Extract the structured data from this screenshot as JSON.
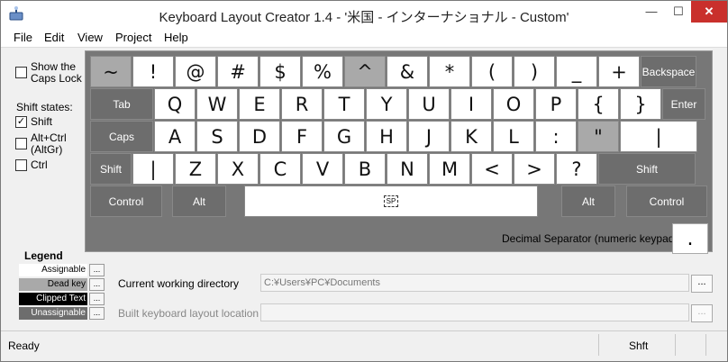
{
  "window": {
    "title": "Keyboard Layout Creator 1.4 - '米国 - インターナショナル - Custom'",
    "minimize": "—",
    "maximize": "☐",
    "close": "✕"
  },
  "menu": {
    "file": "File",
    "edit": "Edit",
    "view": "View",
    "project": "Project",
    "help": "Help"
  },
  "options": {
    "show_caps_lock": "Show the Caps Lock",
    "show_caps_lock_checked": false,
    "shift_states_label": "Shift states:",
    "shift": "Shift",
    "shift_checked": true,
    "altgr": "Alt+Ctrl (AltGr)",
    "altgr_checked": false,
    "ctrl": "Ctrl",
    "ctrl_checked": false
  },
  "keyboard": {
    "rows": [
      [
        {
          "label": "~",
          "kind": "dead"
        },
        {
          "label": "!"
        },
        {
          "label": "@"
        },
        {
          "label": "#"
        },
        {
          "label": "$"
        },
        {
          "label": "%"
        },
        {
          "label": "^",
          "kind": "dead"
        },
        {
          "label": "&"
        },
        {
          "label": "*"
        },
        {
          "label": "("
        },
        {
          "label": ")"
        },
        {
          "label": "_"
        },
        {
          "label": "+"
        },
        {
          "label": "Backspace",
          "kind": "unassign"
        }
      ],
      [
        {
          "label": "Tab",
          "kind": "unassign"
        },
        {
          "label": "Q"
        },
        {
          "label": "W"
        },
        {
          "label": "E"
        },
        {
          "label": "R"
        },
        {
          "label": "T"
        },
        {
          "label": "Y"
        },
        {
          "label": "U"
        },
        {
          "label": "I"
        },
        {
          "label": "O"
        },
        {
          "label": "P"
        },
        {
          "label": "{"
        },
        {
          "label": "}"
        },
        {
          "label": "Enter",
          "kind": "unassign"
        }
      ],
      [
        {
          "label": "Caps",
          "kind": "unassign"
        },
        {
          "label": "A"
        },
        {
          "label": "S"
        },
        {
          "label": "D"
        },
        {
          "label": "F"
        },
        {
          "label": "G"
        },
        {
          "label": "H"
        },
        {
          "label": "J"
        },
        {
          "label": "K"
        },
        {
          "label": "L"
        },
        {
          "label": ":"
        },
        {
          "label": "\"",
          "kind": "dead"
        },
        {
          "label": "|"
        }
      ],
      [
        {
          "label": "Shift",
          "kind": "unassign"
        },
        {
          "label": "|"
        },
        {
          "label": "Z"
        },
        {
          "label": "X"
        },
        {
          "label": "C"
        },
        {
          "label": "V"
        },
        {
          "label": "B"
        },
        {
          "label": "N"
        },
        {
          "label": "M"
        },
        {
          "label": "<"
        },
        {
          "label": ">"
        },
        {
          "label": "?"
        },
        {
          "label": "Shift",
          "kind": "unassign"
        }
      ],
      [
        {
          "label": "Control",
          "kind": "unassign"
        },
        {
          "label": "Alt",
          "kind": "unassign"
        },
        {
          "label": "SP",
          "kind": "space"
        },
        {
          "label": "Alt",
          "kind": "unassign"
        },
        {
          "label": "Control",
          "kind": "unassign"
        }
      ]
    ],
    "decimal_separator_label": "Decimal Separator (numeric keypad)",
    "decimal_separator_value": "."
  },
  "legend": {
    "title": "Legend",
    "items": [
      {
        "label": "Assignable",
        "color": "#ffffff",
        "text_color": "#000000"
      },
      {
        "label": "Dead key",
        "color": "#a9a9a9",
        "text_color": "#000000"
      },
      {
        "label": "Clipped Text",
        "color": "#000000",
        "text_color": "#ffffff"
      },
      {
        "label": "Unassignable",
        "color": "#6d6d6d",
        "text_color": "#ffffff"
      }
    ],
    "button": "..."
  },
  "paths": {
    "cwd_label": "Current working directory",
    "cwd_value": "C:¥Users¥PC¥Documents",
    "built_label": "Built keyboard layout location",
    "built_value": "",
    "browse": "..."
  },
  "status": {
    "ready": "Ready",
    "shift": "Shft"
  }
}
